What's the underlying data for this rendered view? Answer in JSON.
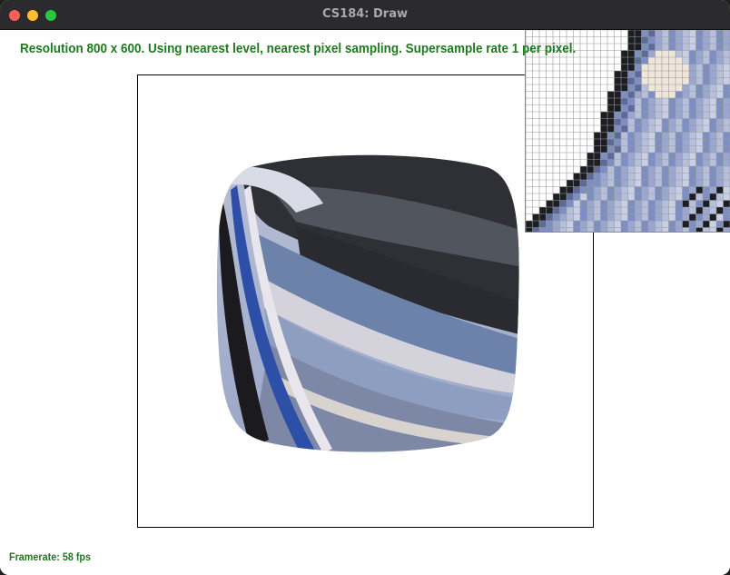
{
  "window": {
    "title": "CS184: Draw",
    "controls": [
      "close",
      "minimize",
      "maximize"
    ]
  },
  "status_line": "Resolution 800 x 600. Using nearest level, nearest pixel sampling. Supersample rate 1 per pixel.",
  "framerate": "Framerate: 58 fps",
  "colors": {
    "status_text": "#1f7a1f",
    "titlebar": "#2b2a2d",
    "close": "#ff5f57",
    "minimize": "#febc2e",
    "maximize": "#28c840"
  },
  "icons": [
    "close-icon",
    "minimize-icon",
    "maximize-icon"
  ]
}
